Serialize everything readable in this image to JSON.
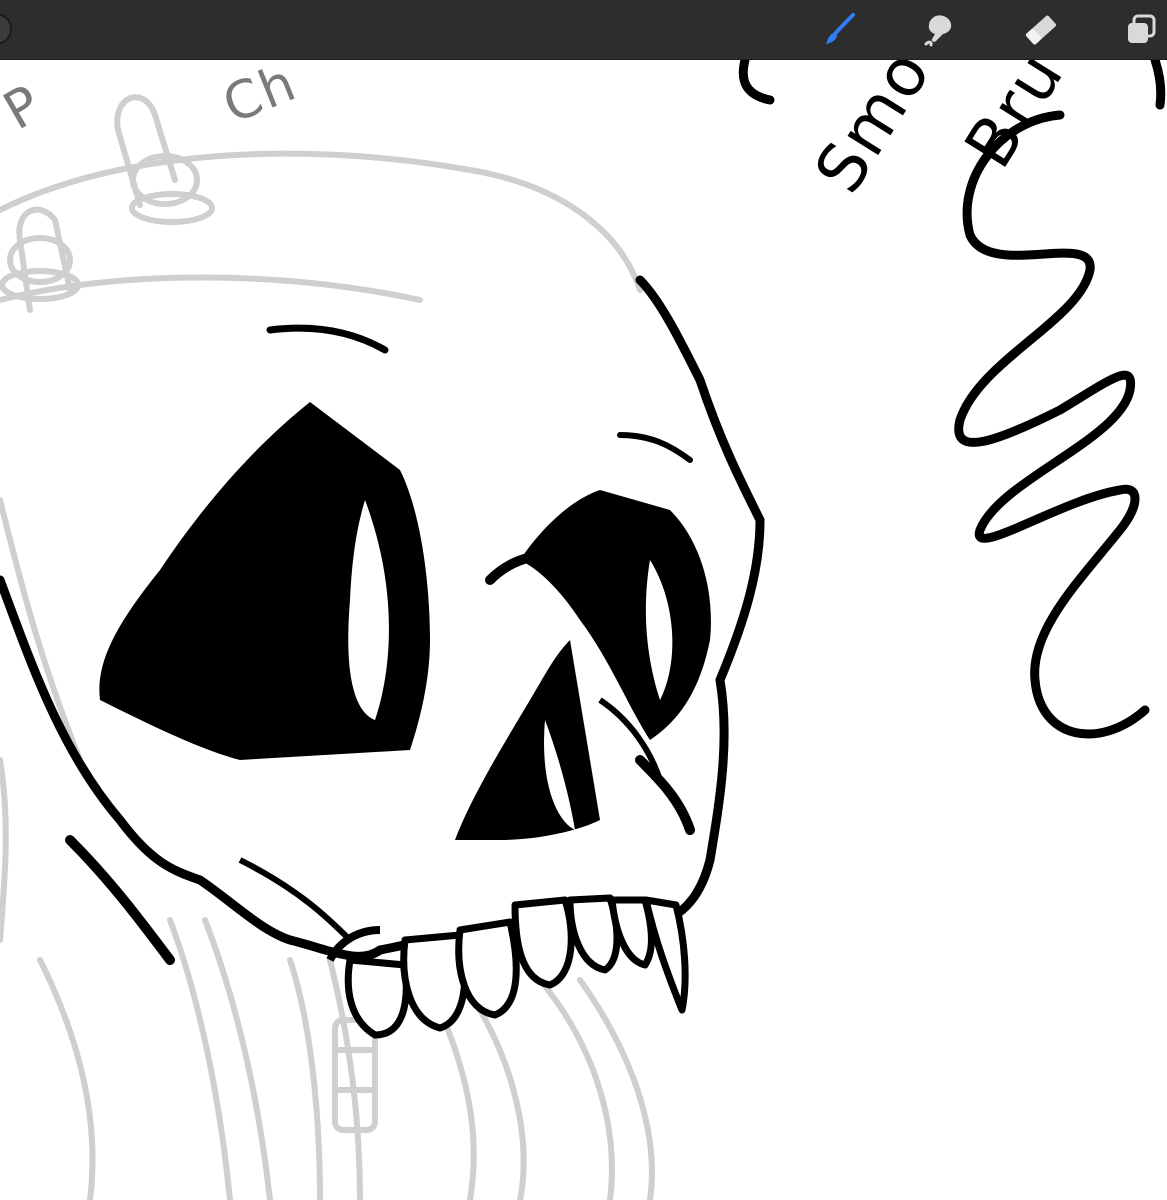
{
  "toolbar": {
    "tools": [
      {
        "id": "brush",
        "icon": "paintbrush-icon",
        "active": true,
        "color": "#2f7cf6"
      },
      {
        "id": "smudge",
        "icon": "smudge-finger-icon",
        "active": false,
        "color": "#d9d9d9"
      },
      {
        "id": "eraser",
        "icon": "eraser-icon",
        "active": false,
        "color": "#d9d9d9"
      },
      {
        "id": "layers",
        "icon": "layers-icon",
        "active": false,
        "color": "#d9d9d9"
      }
    ]
  },
  "canvas": {
    "handwriting_line1": "Smoo",
    "handwriting_line2": "Bru",
    "faint_text_left": "P",
    "faint_text_mid": "Ch",
    "ink_color": "#000000",
    "sketch_color": "#cfcfcf"
  }
}
